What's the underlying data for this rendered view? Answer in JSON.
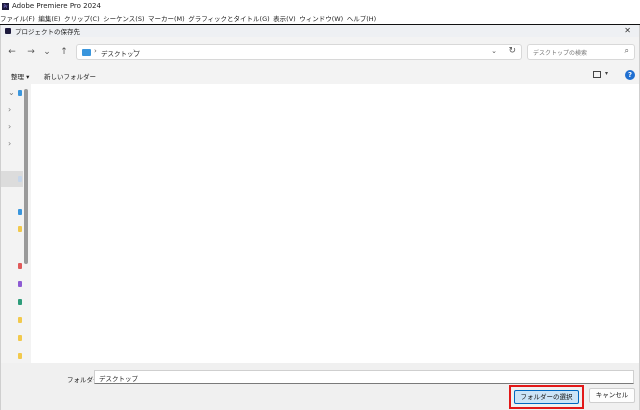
{
  "app": {
    "badge": "Pr",
    "title": "Adobe Premiere Pro 2024"
  },
  "menu": [
    {
      "label": "ファイル(F)"
    },
    {
      "label": "編集(E)"
    },
    {
      "label": "クリップ(C)"
    },
    {
      "label": "シーケンス(S)"
    },
    {
      "label": "マーカー(M)"
    },
    {
      "label": "グラフィックとタイトル(G)"
    },
    {
      "label": "表示(V)"
    },
    {
      "label": "ウィンドウ(W)"
    },
    {
      "label": "ヘルプ(H)"
    }
  ],
  "dialog": {
    "title": "プロジェクトの保存先",
    "close_glyph": "✕",
    "nav": {
      "back": "←",
      "forward": "→",
      "recent": "⌄",
      "up": "↑"
    },
    "address": {
      "chevron": "›",
      "location": "デスクトップ",
      "dropdown": "⌄",
      "refresh": "↻"
    },
    "search": {
      "placeholder": "デスクトップの検索",
      "icon_glyph": "⌕"
    },
    "command_bar": {
      "organize": "整理 ▾",
      "new_folder": "新しいフォルダー",
      "view_dropdown": "▾",
      "help": "?"
    },
    "nav_pane": {
      "chevrons": [
        "⌄",
        "›",
        "›",
        "›"
      ],
      "icon_colors": [
        "#3a96dd",
        "#c6d6ea",
        "#3a96dd",
        "#f2c94c",
        "#e05a5a",
        "#8e5bd3",
        "#2e9c7a",
        "#f2c94c",
        "#f2c94c",
        "#f2c94c"
      ]
    },
    "footer": {
      "folder_label": "フォルダー:",
      "folder_value": "デスクトップ",
      "select_button": "フォルダーの選択",
      "cancel_button": "キャンセル"
    }
  },
  "colors": {
    "highlight_border": "#e21818",
    "primary_button": "#cce4f7",
    "accent": "#0067c0"
  }
}
